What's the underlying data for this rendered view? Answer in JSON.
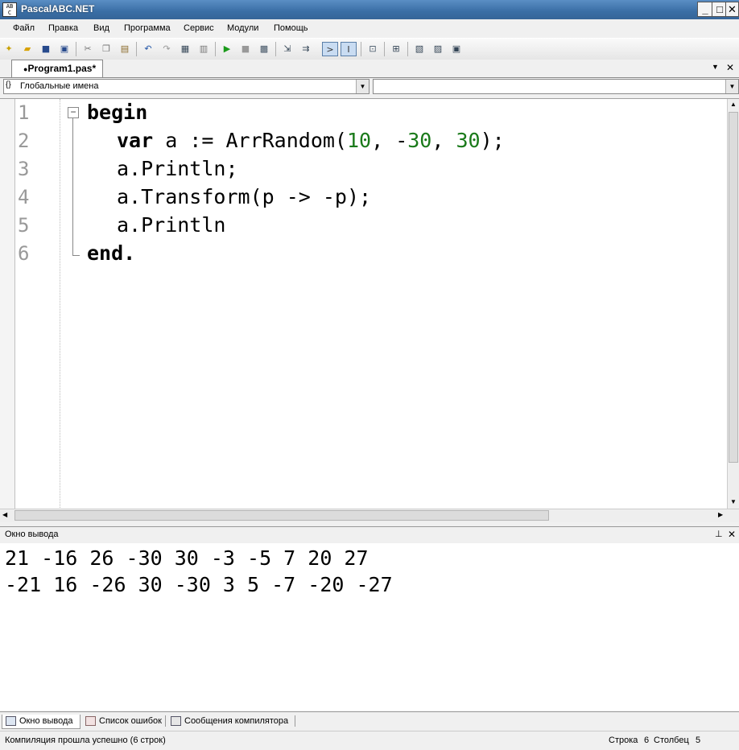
{
  "window": {
    "title": "PascalABC.NET",
    "icon_text": "AB\nC",
    "minimize": "_",
    "maximize": "□",
    "close": "✕"
  },
  "menu": [
    "Файл",
    "Правка",
    "Вид",
    "Программа",
    "Сервис",
    "Модули",
    "Помощь"
  ],
  "toolbar_icons": [
    "new-file-icon",
    "open-icon",
    "save-icon",
    "save-all-icon",
    "cut-icon",
    "copy-icon",
    "paste-icon",
    "undo-icon",
    "redo-icon",
    "bookmark-icon",
    "print-icon",
    "run-icon",
    "stop-icon",
    "debug-icon",
    "step-into-icon",
    "step-over-icon",
    "console-icon",
    "format-icon",
    "compile-icon",
    "form-designer-icon",
    "ref-icon",
    "tree-icon",
    "reference-icon"
  ],
  "tab": {
    "label": "Program1.pas*",
    "bullet": "●"
  },
  "tab_controls": {
    "dropdown": "▼",
    "close": "✕"
  },
  "combos": {
    "left_value": "Глобальные имена",
    "left_icon": "{}",
    "right_value": ""
  },
  "editor": {
    "line_numbers": [
      "1",
      "2",
      "3",
      "4",
      "5",
      "6"
    ],
    "fold_marker": "−",
    "lines": {
      "l1": "begin",
      "l2_kw": "var",
      "l2_a": " a := ArrRandom(",
      "l2_n1": "10",
      "l2_b": ", -",
      "l2_n2": "30",
      "l2_c": ", ",
      "l2_n3": "30",
      "l2_d": ");",
      "l3": "a.Println;",
      "l4": "a.Transform(p -> -p);",
      "l5": "a.Println",
      "l6": "end."
    }
  },
  "output": {
    "title": "Окно вывода",
    "pin": "⊥",
    "close": "✕",
    "lines": [
      "21 -16 26 -30 30 -3 -5 7 20 27",
      "-21 16 -26 30 -30 3 5 -7 -20 -27"
    ]
  },
  "bottom_tabs": [
    "Окно вывода",
    "Список ошибок",
    "Сообщения компилятора"
  ],
  "status": {
    "message": "Компиляция прошла успешно (6 строк)",
    "row_label": "Строка",
    "row_value": "6",
    "col_label": "Столбец",
    "col_value": "5"
  }
}
